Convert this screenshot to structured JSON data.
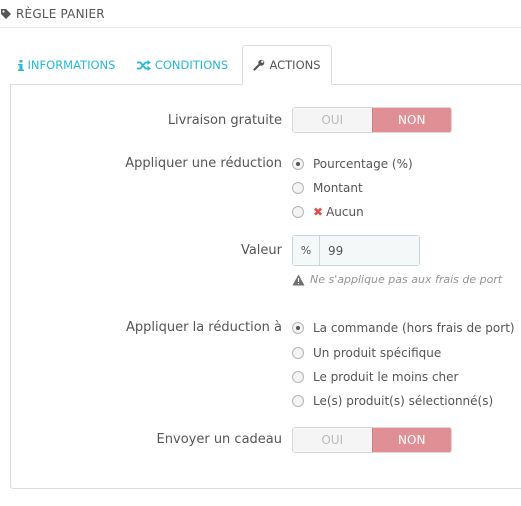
{
  "header": {
    "title": "Règle panier",
    "icon": "tag-icon"
  },
  "tabs": [
    {
      "label": "Informations",
      "icon": "info-icon"
    },
    {
      "label": "Conditions",
      "icon": "shuffle-icon"
    },
    {
      "label": "Actions",
      "icon": "wrench-icon"
    }
  ],
  "active_tab": "Actions",
  "free_shipping": {
    "label": "Livraison gratuite",
    "yes": "OUI",
    "no": "NON",
    "selected": "NON"
  },
  "apply_discount": {
    "label": "Appliquer une réduction",
    "options": [
      "Pourcentage (%)",
      "Montant",
      "Aucun"
    ],
    "selected": "Pourcentage (%)"
  },
  "value": {
    "label": "Valeur",
    "addon": "%",
    "value": "99"
  },
  "help": {
    "text": "Ne s'applique pas aux frais de port",
    "icon": "warning-icon"
  },
  "apply_to": {
    "label": "Appliquer la réduction à",
    "options": [
      "La commande (hors frais de port)",
      "Un produit spécifique",
      "Le produit le moins cher",
      "Le(s) produit(s) sélectionné(s)"
    ],
    "selected": "La commande (hors frais de port)"
  },
  "send_gift": {
    "label": "Envoyer un cadeau",
    "yes": "OUI",
    "no": "NON",
    "selected": "NON"
  }
}
